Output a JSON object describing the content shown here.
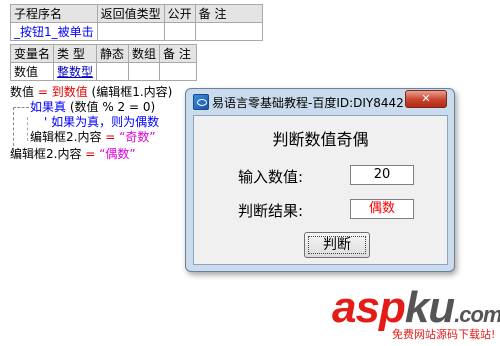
{
  "sub_table": {
    "headers": [
      "子程序名",
      "返回值类型",
      "公开",
      "备 注"
    ],
    "row": [
      "_按钮1_被单击",
      "",
      "",
      ""
    ]
  },
  "var_table": {
    "headers": [
      "变量名",
      "类 型",
      "静态",
      "数组",
      "备 注"
    ],
    "row": [
      "数值",
      "整数型",
      "",
      "",
      ""
    ]
  },
  "code": {
    "line1_var": "数值",
    "line1_op": " = ",
    "line1_func": "到数值",
    "line1_arg": " (编辑框1.内容)",
    "line2_kw": "如果真",
    "line2_cond": " (数值 % 2 = 0)",
    "line3_comment": "' 如果为真，则为偶数",
    "line4_obj": "编辑框2.内容",
    "line4_op": " = ",
    "line4_str": "“奇数”",
    "line5_obj": "编辑框2.内容",
    "line5_op": " = ",
    "line5_str": "“偶数”"
  },
  "dialog": {
    "title": "易语言零基础教程-百度ID:DIY8442",
    "close_label": "✕",
    "heading": "判断数值奇偶",
    "input_label": "输入数值:",
    "input_value": "20",
    "result_label": "判断结果:",
    "result_value": "偶数",
    "button_label": "判断"
  },
  "watermark": {
    "logo_a": "asp",
    "logo_b": "ku",
    "logo_c": ".com",
    "sub": "免费网站源码下载站!"
  },
  "colors": {
    "result_text": "#ff0000",
    "keyword_red": "#e00000",
    "keyword_blue": "#0000ff",
    "string": "#e000e0"
  }
}
